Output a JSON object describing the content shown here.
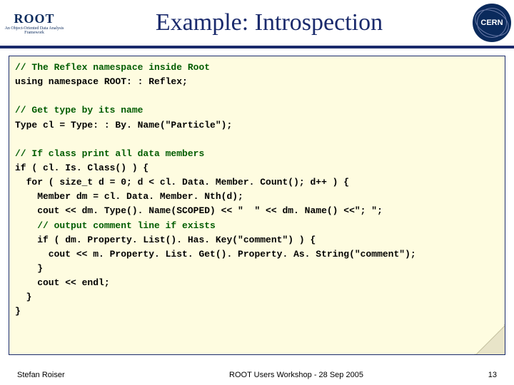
{
  "header": {
    "root_logo_text": "ROOT",
    "root_logo_sub": "An Object-Oriented\nData Analysis Framework",
    "title": "Example: Introspection",
    "cern_text": "CERN"
  },
  "code": {
    "c1": "// The Reflex namespace inside Root",
    "l1": "using namespace ROOT: : Reflex;",
    "c2": "// Get type by its name",
    "l2": "Type cl = Type: : By. Name(\"Particle\");",
    "c3": "// If class print all data members",
    "l3": "if ( cl. Is. Class() ) {",
    "l4": "  for ( size_t d = 0; d < cl. Data. Member. Count(); d++ ) {",
    "l5": "    Member dm = cl. Data. Member. Nth(d);",
    "l6": "    cout << dm. Type(). Name(SCOPED) << \"  \" << dm. Name() <<\"; \";",
    "c4": "    // output comment line if exists",
    "l7": "    if ( dm. Property. List(). Has. Key(\"comment\") ) {",
    "l8": "      cout << m. Property. List. Get(). Property. As. String(\"comment\");",
    "l9": "    }",
    "l10": "    cout << endl;",
    "l11": "  }",
    "l12": "}"
  },
  "footer": {
    "author": "Stefan Roiser",
    "center": "ROOT Users Workshop  -  28 Sep 2005",
    "page": "13"
  }
}
